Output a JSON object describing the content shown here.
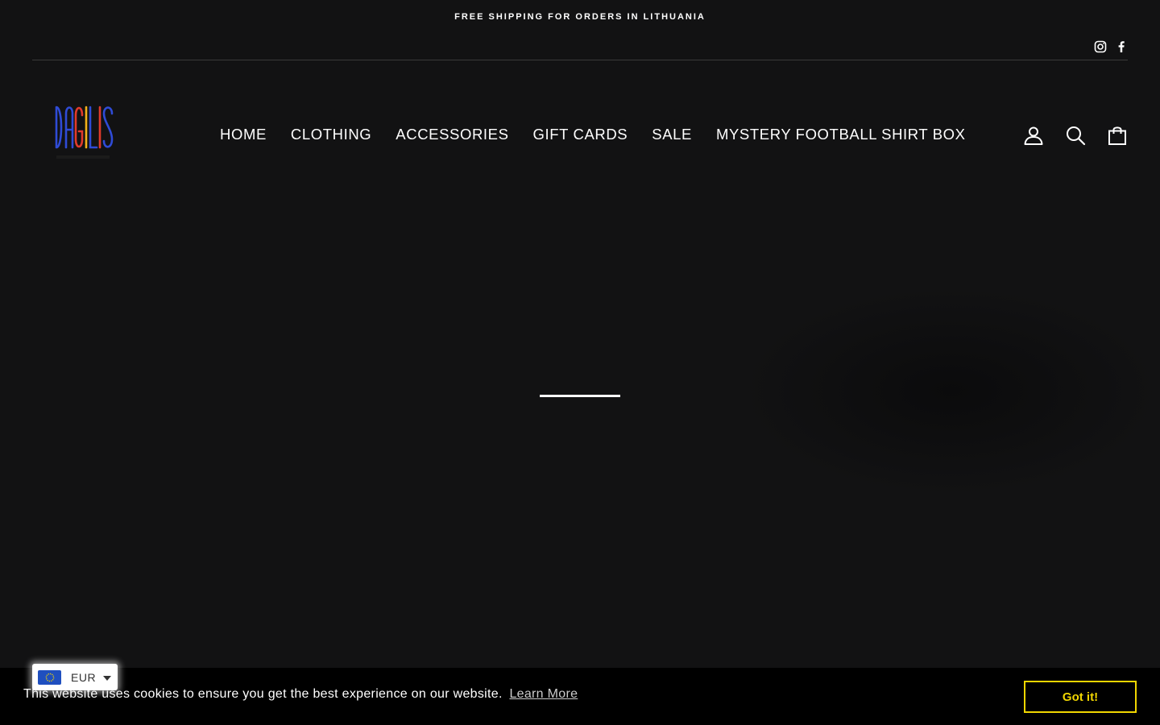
{
  "announcement": {
    "text": "FREE SHIPPING FOR ORDERS IN LITHUANIA"
  },
  "social": {
    "icons": [
      "instagram-icon",
      "facebook-icon"
    ]
  },
  "brand": {
    "logo_alt": "DAGILIS"
  },
  "nav": {
    "items": [
      {
        "label": "HOME"
      },
      {
        "label": "CLOTHING"
      },
      {
        "label": "ACCESSORIES"
      },
      {
        "label": "GIFT CARDS"
      },
      {
        "label": "SALE"
      },
      {
        "label": "MYSTERY FOOTBALL SHIRT BOX"
      }
    ]
  },
  "header_icons": [
    "account-icon",
    "search-icon",
    "cart-icon"
  ],
  "cookie": {
    "message": "This website uses cookies to ensure you get the best experience on our website.",
    "learn_more": "Learn More",
    "accept": "Got it!"
  },
  "currency": {
    "code": "EUR",
    "flag": "eu-flag-icon"
  },
  "colors": {
    "background": "#121213",
    "cookie_bar": "#000000",
    "cookie_button": "#f1d600",
    "logo_blue": "#2f4bd6",
    "logo_red": "#e03a2c",
    "logo_yellow": "#f2b21a"
  }
}
